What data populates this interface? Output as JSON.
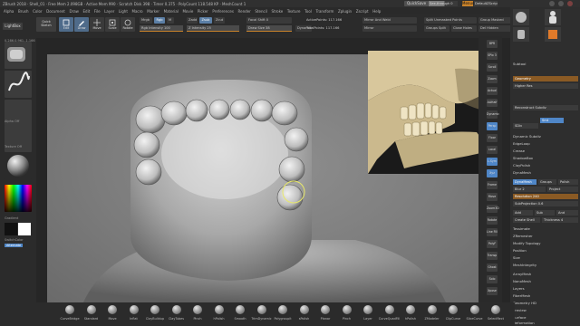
{
  "window": {
    "title": "ZBrush 2018 · Shell_01 · Free Mem 2.098GB · Active Mem 990 · Scratch Disk 398 · Timer 0.375 · PolyCount 118.548 KP · MeshCount 1",
    "quicksave": "QuickSave",
    "seethrough": "See-through 0",
    "menus": "Menus",
    "default_script": "DefaultZScript"
  },
  "menubar": [
    "Alpha",
    "Brush",
    "Color",
    "Document",
    "Draw",
    "Edit",
    "File",
    "Layer",
    "Light",
    "Macro",
    "Marker",
    "Material",
    "Movie",
    "Picker",
    "Preferences",
    "Render",
    "Stencil",
    "Stroke",
    "Texture",
    "Tool",
    "Transform",
    "Zplugin",
    "Zscript",
    "Help"
  ],
  "toolbar": {
    "lightbox": "LightBox",
    "quicksketch": "Quick Sketch",
    "edit": "Edit",
    "draw": "Draw",
    "move": "Move",
    "scale": "Scale",
    "rotate": "Rotate",
    "mrgb": "Mrgb",
    "rgb": "Rgb",
    "m": "M",
    "rgb_intensity": "Rgb Intensity 100",
    "zadd": "Zadd",
    "zsub": "Zsub",
    "zcut": "Zcut",
    "z_intensity": "Z Intensity 25",
    "focal_shift": "Focal Shift 0",
    "draw_size": "Draw Size 38",
    "dynamic": "Dynamic",
    "active_points": "ActivePoints: 117.166",
    "total_points": "TotalPoints: 117.166",
    "mirror_weld": "Mirror And Weld",
    "mirror": "Mirror",
    "split_unmasked": "Split Unmasked Points",
    "groups_split": "Groups Split",
    "close_holes": "Close Holes",
    "group_masked": "Group Masked",
    "del_hidden": "Del Hidden"
  },
  "coords": "0.286,0.961,-1.166",
  "left_shelf": {
    "alpha_off": "Alpha Off",
    "texture_off": "Texture Off",
    "gradient": "Gradient",
    "switch_color": "SwitchColor",
    "alternate": "Alternate"
  },
  "right_strip": [
    "BPR",
    "SPix 3",
    "Scroll",
    "Zoom",
    "Actual",
    "AAHalf",
    "Dynamic",
    "Persp",
    "Floor",
    "Local",
    "L.Sym",
    "Xyz",
    "Frame",
    "Move",
    "Zoom3D",
    "Rotate",
    "Line Fill",
    "PolyF",
    "Transp",
    "Ghost",
    "Solo",
    "Xpose"
  ],
  "right_panel": {
    "top_thumbs": [
      "PolySphere",
      "Shell_01",
      "Cylinder3D",
      "SimpleBrush"
    ],
    "items": [
      "Subtool",
      "Geometry",
      "Higher Res",
      "Reconstruct Subdiv",
      "Del Lower",
      "Del Higher",
      "Freeze SubDivision Levels",
      "Smt",
      "Dynamic Subdiv",
      "EdgeLoop",
      "Crease",
      "ShadowBox",
      "ClayPolish",
      "DynaMesh",
      "Tessimate",
      "ZRemesher",
      "Modify Topology",
      "Position",
      "Size",
      "MeshIntegrity",
      "ArrayMesh",
      "NanoMesh",
      "Layers",
      "FiberMesh",
      "Geometry HD",
      "Preview",
      "Surface",
      "Deformation"
    ],
    "subdiv": "SDiv",
    "dynamesh_btn": "DynaMesh",
    "groups": "Groups",
    "polish": "Polish",
    "blur": "Blur 2",
    "project": "Project",
    "resolution": "Resolution 240",
    "subprojection": "SubProjection 0.6",
    "add": "Add",
    "sub": "Sub",
    "and": "And",
    "create_shell": "Create Shell",
    "thickness": "Thickness 4"
  },
  "bottom_brushes": [
    "CurveBridge",
    "Standard",
    "Move",
    "Inflat",
    "ClayBuildup",
    "ClayTubes",
    "Pinch",
    "hPolish",
    "Smooth",
    "TrimDynamic",
    "Polygroupit",
    "sPolish",
    "Planar",
    "Pinch",
    "Layer",
    "CurveQuadFill",
    "hPolish",
    "ZModeler",
    "ClipCurve",
    "SliceCurve",
    "SelectRect"
  ],
  "colors": {
    "accent_orange": "#c8822a",
    "accent_blue": "#4f86c7",
    "panel": "#2e2e2e"
  }
}
